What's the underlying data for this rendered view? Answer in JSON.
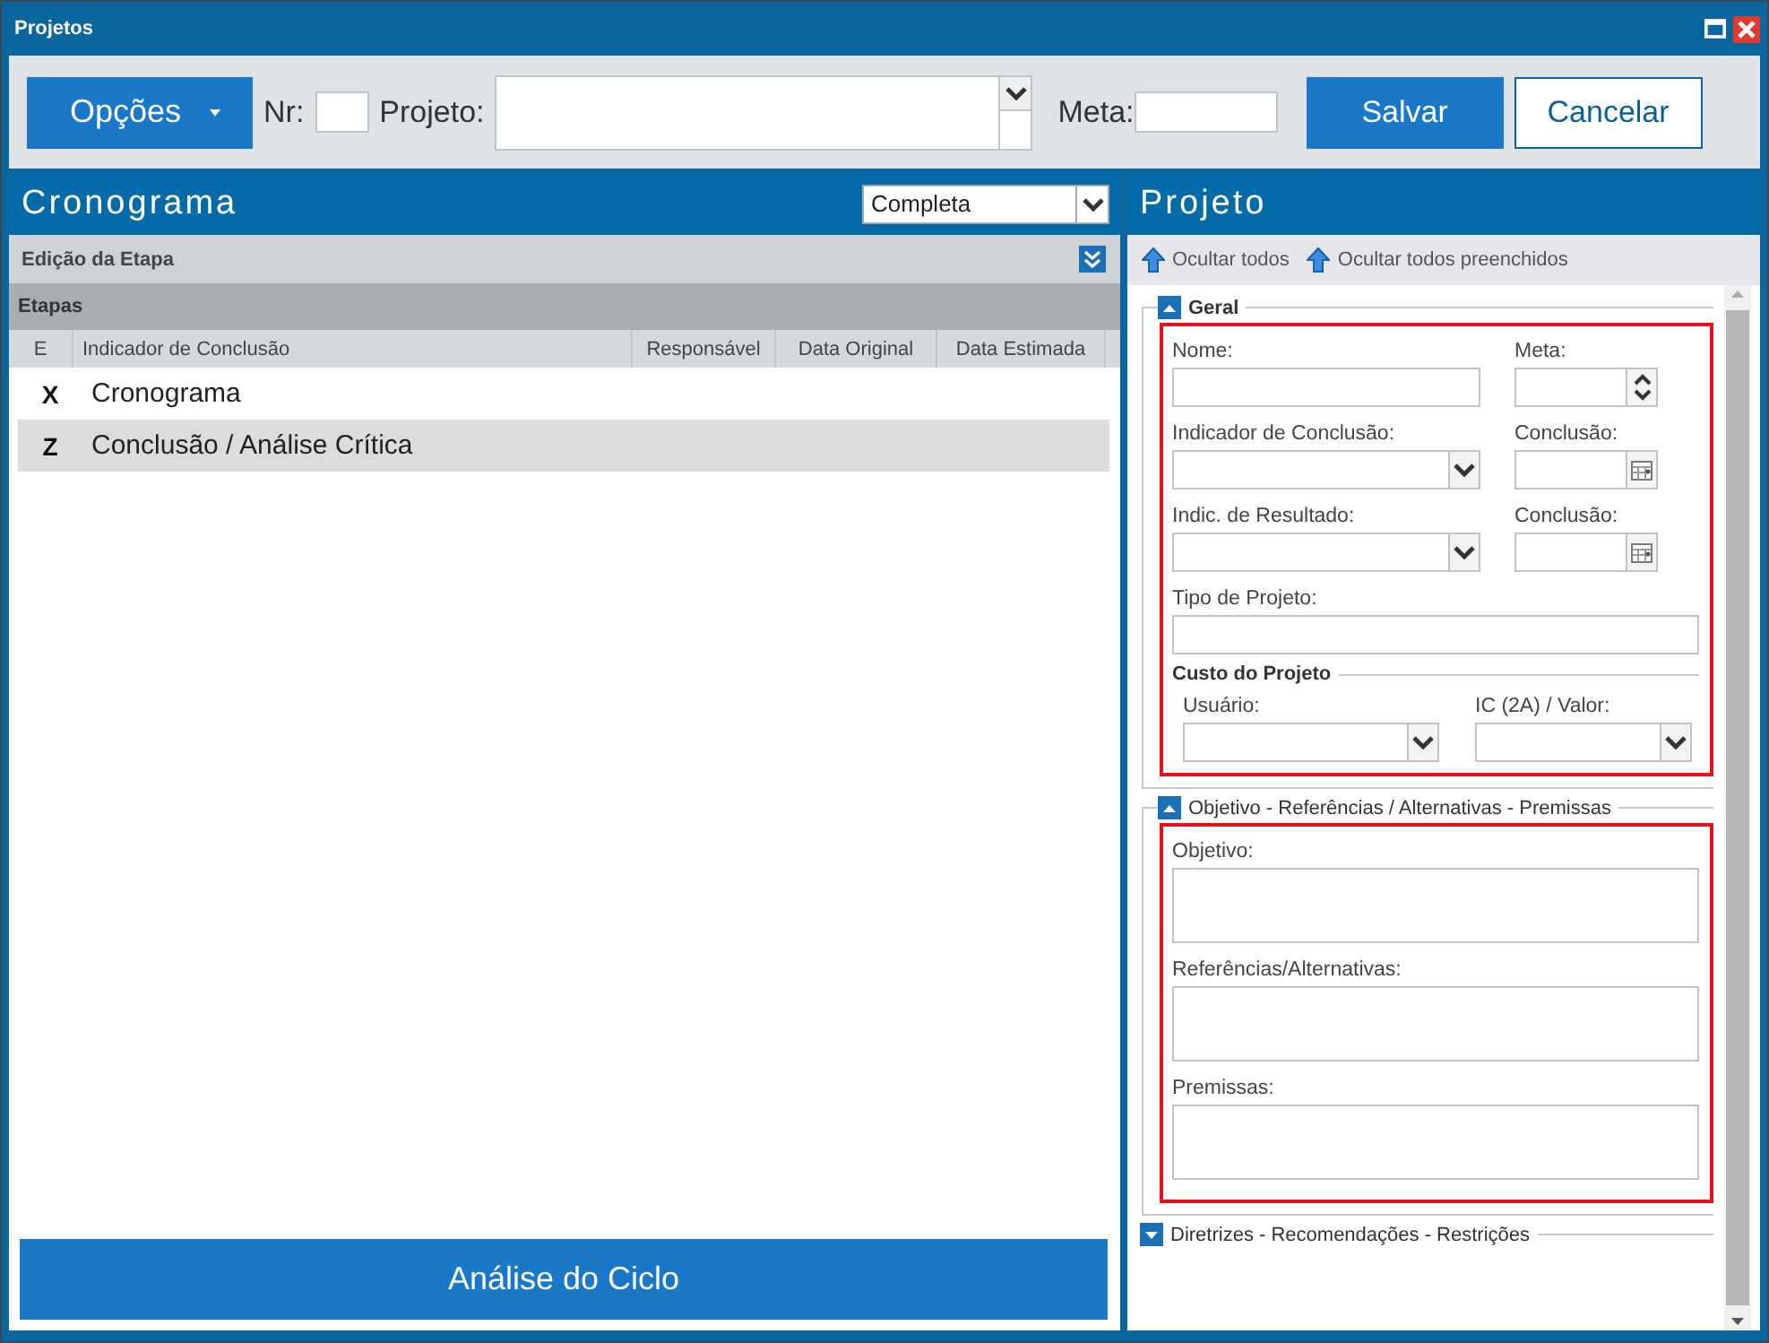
{
  "window": {
    "title": "Projetos"
  },
  "toolbar": {
    "options_button": "Opções",
    "nr_label": "Nr:",
    "project_label": "Projeto:",
    "meta_label": "Meta:",
    "save_button": "Salvar",
    "cancel_button": "Cancelar"
  },
  "schedule": {
    "title": "Cronograma",
    "view_select": "Completa",
    "edit_bar": "Edição da Etapa",
    "steps_header": "Etapas",
    "columns": [
      "E",
      "Indicador de Conclusão",
      "Responsável",
      "Data Original",
      "Data Estimada"
    ],
    "rows": [
      {
        "code": "X",
        "name": "Cronograma",
        "selected": false
      },
      {
        "code": "Z",
        "name": "Conclusão / Análise Crítica",
        "selected": true
      }
    ],
    "cycle_button": "Análise do Ciclo"
  },
  "project": {
    "title": "Projeto",
    "actions": [
      "Ocultar todos",
      "Ocultar todos preenchidos"
    ],
    "sections": [
      {
        "title": "Geral",
        "expanded": true,
        "highlighted": true,
        "rows": [
          [
            {
              "label": "Nome:",
              "kind": "text"
            },
            {
              "label": "Meta:",
              "kind": "spinner"
            }
          ],
          [
            {
              "label": "Indicador de Conclusão:",
              "kind": "select"
            },
            {
              "label": "Conclusão:",
              "kind": "date"
            }
          ],
          [
            {
              "label": "Indic. de Resultado:",
              "kind": "select"
            },
            {
              "label": "Conclusão:",
              "kind": "date"
            }
          ],
          [
            {
              "label": "Tipo de Projeto:",
              "kind": "text"
            }
          ]
        ],
        "subgroup": {
          "title": "Custo do Projeto",
          "fields": [
            {
              "label": "Usuário:",
              "kind": "select"
            },
            {
              "label": "IC (2A) / Valor:",
              "kind": "select"
            }
          ]
        }
      },
      {
        "title": "Objetivo - Referências / Alternativas - Premissas",
        "expanded": true,
        "highlighted": true,
        "rows": [
          [
            {
              "label": "Objetivo:",
              "kind": "textarea"
            }
          ],
          [
            {
              "label": "Referências/Alternativas:",
              "kind": "textarea"
            }
          ],
          [
            {
              "label": "Premissas:",
              "kind": "textarea"
            }
          ]
        ]
      },
      {
        "title": "Diretrizes - Recomendações - Restrições",
        "expanded": false
      }
    ]
  }
}
